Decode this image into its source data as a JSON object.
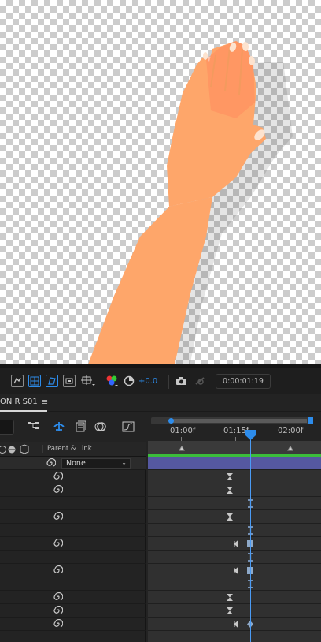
{
  "viewer": {
    "toolbar": {
      "exposure_value": "+0.0",
      "timecode": "0:00:01:19",
      "icons": [
        "region-of-interest-icon",
        "transparency-grid-icon",
        "mask-path-icon",
        "3d-view-icon",
        "guides-icon",
        "color-channels-icon",
        "reset-exposure-icon",
        "snapshot-icon",
        "show-snapshot-icon"
      ]
    }
  },
  "composition_tab": {
    "label": "ON R S01",
    "menu_icon": "hamburger-menu-icon"
  },
  "layer_panel": {
    "column_header": "Parent & Link",
    "top_layer_parent_value": "None"
  },
  "timeline": {
    "ruler_labels": [
      "01:00f",
      "01:15f",
      "02:00f"
    ],
    "current_time_indicator_color": "#4a9bf5"
  },
  "colors": {
    "accent": "#2d8ceb",
    "layer_bar": "#5558a0",
    "work_area_green": "#3bbd3b",
    "skin": "#fea66a"
  }
}
